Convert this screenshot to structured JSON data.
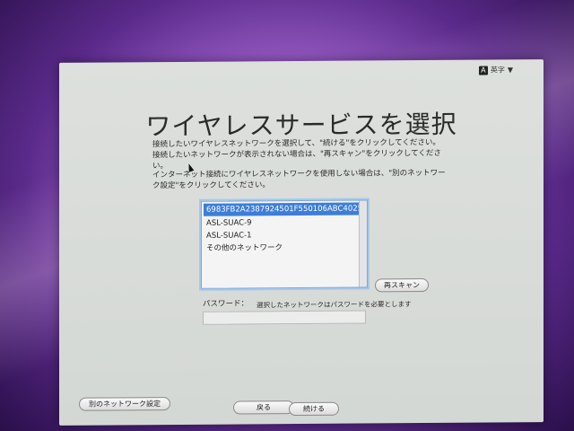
{
  "header": {
    "language_label": "英字",
    "language_icon_glyph": "A",
    "language_chevron": "▼"
  },
  "main": {
    "title": "ワイヤレスサービスを選択",
    "instructions": [
      "接続したいワイヤレスネットワークを選択して、\"続ける\"をクリックしてください。",
      "接続したいネットワークが表示されない場合は、\"再スキャン\"をクリックしてください。"
    ],
    "instructions2": "インターネット接続にワイヤレスネットワークを使用しない場合は、\"別のネットワーク設定\"をクリックしてください。",
    "networks": [
      {
        "label": "6983FB2A2387924501F550106ABC4025",
        "selected": true
      },
      {
        "label": "ASL-SUAC-9",
        "selected": false
      },
      {
        "label": "ASL-SUAC-1",
        "selected": false
      },
      {
        "label": "その他のネットワーク",
        "selected": false
      }
    ],
    "rescan_label": "再スキャン",
    "password_label": "パスワード：",
    "password_hint": "選択したネットワークはパスワードを必要とします",
    "password_value": ""
  },
  "footer": {
    "other_network_label": "別のネットワーク設定",
    "back_label": "戻る",
    "continue_label": "続ける"
  },
  "colors": {
    "selection": "#3c7ed8",
    "panel": "#d8dcd8",
    "wallpaper": "#9b5fc8"
  }
}
